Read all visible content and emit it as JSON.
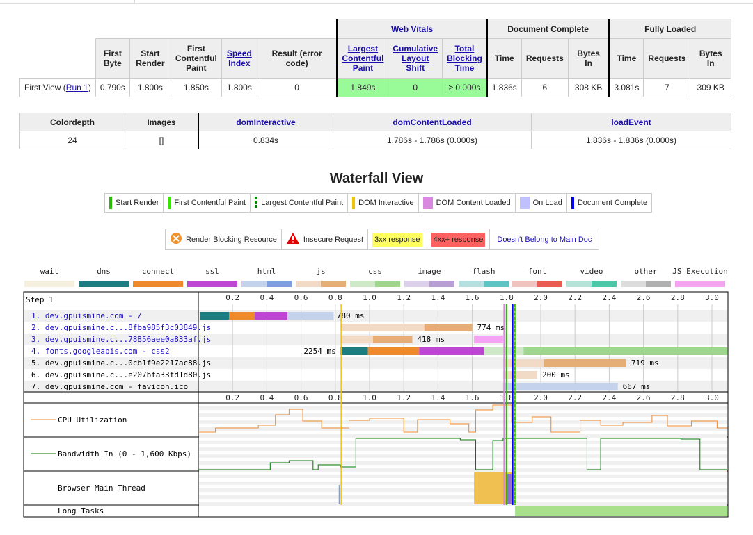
{
  "summary": {
    "groups": {
      "web_vitals": "Web Vitals",
      "document_complete": "Document Complete",
      "fully_loaded": "Fully Loaded"
    },
    "headers": {
      "first_byte": "First Byte",
      "start_render": "Start Render",
      "fcp": "First Contentful Paint",
      "speed_index": "Speed Index",
      "result": "Result (error code)",
      "lcp": "Largest Contentful Paint",
      "cls": "Cumulative Layout Shift",
      "tbt": "Total Blocking Time",
      "time": "Time",
      "requests": "Requests",
      "bytes_in": "Bytes In"
    },
    "row": {
      "label_prefix": "First View (",
      "run_link": "Run 1",
      "label_suffix": ")",
      "first_byte": "0.790s",
      "start_render": "1.800s",
      "fcp": "1.850s",
      "speed_index": "1.800s",
      "result": "0",
      "lcp": "1.849s",
      "cls": "0",
      "tbt": "≥ 0.000s",
      "dc_time": "1.836s",
      "dc_requests": "6",
      "dc_bytes": "308 KB",
      "fl_time": "3.081s",
      "fl_requests": "7",
      "fl_bytes": "309 KB"
    }
  },
  "metrics": {
    "headers": {
      "colordepth": "Colordepth",
      "images": "Images",
      "dom_interactive": "domInteractive",
      "dom_content_loaded": "domContentLoaded",
      "load_event": "loadEvent"
    },
    "values": {
      "colordepth": "24",
      "images": "[]",
      "dom_interactive": "0.834s",
      "dom_content_loaded": "1.786s - 1.786s (0.000s)",
      "load_event": "1.836s - 1.836s (0.000s)"
    }
  },
  "waterfall_title": "Waterfall View",
  "legend1": [
    {
      "label": "Start Render",
      "color": "#28bc00",
      "kind": "line"
    },
    {
      "label": "First Contentful Paint",
      "color": "#39e600",
      "kind": "line"
    },
    {
      "label": "Largest Contentful Paint",
      "color": "#008000",
      "kind": "dash"
    },
    {
      "label": "DOM Interactive",
      "color": "#f5c400",
      "kind": "line"
    },
    {
      "label": "DOM Content Loaded",
      "color": "#d888df",
      "kind": "box"
    },
    {
      "label": "On Load",
      "color": "#c0c0ff",
      "kind": "box"
    },
    {
      "label": "Document Complete",
      "color": "#0000ff",
      "kind": "line"
    }
  ],
  "legend2": {
    "render_blocking": "Render Blocking Resource",
    "insecure": "Insecure Request",
    "r3xx": "3xx response",
    "r4xx": "4xx+ response",
    "not_main": "Doesn't Belong to Main Doc"
  },
  "type_legend": [
    {
      "label": "wait",
      "c1": "#f4efde",
      "c2": "#f4efde"
    },
    {
      "label": "dns",
      "c1": "#1c7c82",
      "c2": "#1c7c82"
    },
    {
      "label": "connect",
      "c1": "#ef8a2c",
      "c2": "#ef8a2c"
    },
    {
      "label": "ssl",
      "c1": "#bd47d3",
      "c2": "#bd47d3"
    },
    {
      "label": "html",
      "c1": "#c4d2ec",
      "c2": "#7f9fe0"
    },
    {
      "label": "js",
      "c1": "#f2dbc6",
      "c2": "#e5ae77"
    },
    {
      "label": "css",
      "c1": "#cfe8c8",
      "c2": "#9fd68e"
    },
    {
      "label": "image",
      "c1": "#ddd0ea",
      "c2": "#b79fd6"
    },
    {
      "label": "flash",
      "c1": "#b6e0e0",
      "c2": "#5ec3c3"
    },
    {
      "label": "font",
      "c1": "#f2c2c0",
      "c2": "#e95a50"
    },
    {
      "label": "video",
      "c1": "#b4e4d8",
      "c2": "#4ac8a8"
    },
    {
      "label": "other",
      "c1": "#dcdcdc",
      "c2": "#b0b0b0"
    },
    {
      "label": "JS Execution",
      "c1": "#f4a4f0",
      "c2": "#f4a4f0"
    }
  ],
  "step_label": "Step_1",
  "axis_ticks": [
    "0.2",
    "0.4",
    "0.6",
    "0.8",
    "1.0",
    "1.2",
    "1.4",
    "1.6",
    "1.8",
    "2.0",
    "2.2",
    "2.4",
    "2.6",
    "2.8",
    "3.0"
  ],
  "requests": [
    {
      "label": "1. dev.gpuismine.com - /",
      "duration": "780 ms",
      "blue": true
    },
    {
      "label": "2. dev.gpuismine.c...8fba985f3c03849.js",
      "duration": "774 ms",
      "blue": true
    },
    {
      "label": "3. dev.gpuismine.c...78856aee0a833af.js",
      "duration": "418 ms",
      "blue": true
    },
    {
      "label": "4. fonts.googleapis.com - css2",
      "duration": "2254 ms",
      "blue": true
    },
    {
      "label": "5. dev.gpuismine.c...0cb1f9e2217ac88.js",
      "duration": "719 ms",
      "blue": false
    },
    {
      "label": "6. dev.gpuismine.c...e207bfa33fd1d80.js",
      "duration": "200 ms",
      "blue": false
    },
    {
      "label": "7. dev.gpuismine.com - favicon.ico",
      "duration": "667 ms",
      "blue": false
    }
  ],
  "graphs": {
    "cpu": "CPU Utilization",
    "bandwidth": "Bandwidth In (0 - 1,600 Kbps)",
    "main_thread": "Browser Main Thread",
    "long_tasks": "Long Tasks"
  }
}
